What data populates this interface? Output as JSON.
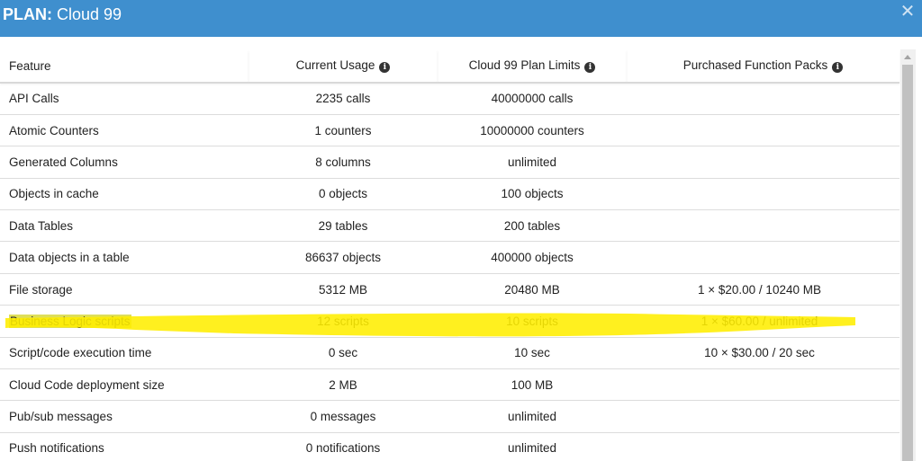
{
  "dialog": {
    "title_prefix": "PLAN:",
    "title_name": " Cloud 99",
    "close_glyph": "✕"
  },
  "table": {
    "headers": {
      "feature": "Feature",
      "usage": "Current Usage",
      "limits": "Cloud 99 Plan Limits",
      "packs": "Purchased Function Packs",
      "info_glyph": "i"
    },
    "rows": [
      {
        "feature": "API Calls",
        "usage": "2235 calls",
        "limit": "40000000 calls",
        "packs": ""
      },
      {
        "feature": "Atomic Counters",
        "usage": "1 counters",
        "limit": "10000000 counters",
        "packs": ""
      },
      {
        "feature": "Generated Columns",
        "usage": "8 columns",
        "limit": "unlimited",
        "packs": ""
      },
      {
        "feature": "Objects in cache",
        "usage": "0 objects",
        "limit": "100 objects",
        "packs": ""
      },
      {
        "feature": "Data Tables",
        "usage": "29 tables",
        "limit": "200 tables",
        "packs": ""
      },
      {
        "feature": "Data objects in a table",
        "usage": "86637 objects",
        "limit": "400000 objects",
        "packs": ""
      },
      {
        "feature": "File storage",
        "usage": "5312 MB",
        "limit": "20480 MB",
        "packs": "1 × $20.00 / 10240 MB"
      },
      {
        "feature": "Business Logic scripts",
        "usage": "12 scripts",
        "limit": "10 scripts",
        "packs": "1 × $60.00 / unlimited"
      },
      {
        "feature": "Script/code execution time",
        "usage": "0 sec",
        "limit": "10 sec",
        "packs": "10 × $30.00 / 20 sec"
      },
      {
        "feature": "Cloud Code deployment size",
        "usage": "2 MB",
        "limit": "100 MB",
        "packs": ""
      },
      {
        "feature": "Pub/sub messages",
        "usage": "0 messages",
        "limit": "unlimited",
        "packs": ""
      },
      {
        "feature": "Push notifications",
        "usage": "0 notifications",
        "limit": "unlimited",
        "packs": ""
      }
    ]
  },
  "colors": {
    "header_bg": "#3f8fce",
    "highlighter": "#ffee00",
    "label_highlight": "#dede5a"
  }
}
